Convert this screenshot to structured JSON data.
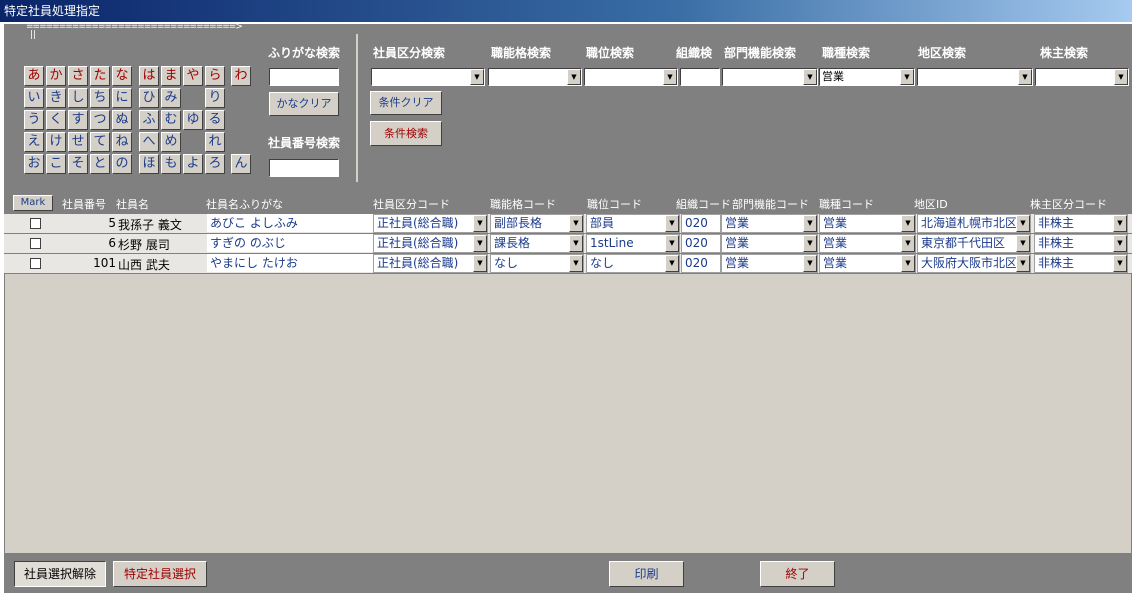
{
  "window": {
    "title": "特定社員処理指定"
  },
  "kana": {
    "arrow": "================================>",
    "tick": "||",
    "rows": [
      [
        "あ",
        "か",
        "さ",
        "た",
        "な",
        "は",
        "ま",
        "や",
        "ら",
        "わ"
      ],
      [
        "い",
        "き",
        "し",
        "ち",
        "に",
        "ひ",
        "み",
        "",
        "り",
        ""
      ],
      [
        "う",
        "く",
        "す",
        "つ",
        "ぬ",
        "ふ",
        "む",
        "ゆ",
        "る",
        ""
      ],
      [
        "え",
        "け",
        "せ",
        "て",
        "ね",
        "へ",
        "め",
        "",
        "れ",
        ""
      ],
      [
        "お",
        "こ",
        "そ",
        "と",
        "の",
        "ほ",
        "も",
        "よ",
        "ろ",
        "ん"
      ]
    ]
  },
  "search": {
    "furigana_label": "ふりがな検索",
    "kana_clear": "かなクリア",
    "empno_label": "社員番号検索",
    "labels": {
      "shain_kubun": "社員区分検索",
      "nouryoku": "職能格検索",
      "shokui": "職位検索",
      "soshiki": "組織検",
      "bumon": "部門機能検索",
      "shokushu": "職種検索",
      "chiku": "地区検索",
      "kabunushi": "株主検索"
    },
    "shokushu_value": "営業",
    "cond_clear": "条件クリア",
    "cond_search": "条件検索"
  },
  "list": {
    "mark": "Mark",
    "headers": {
      "no": "社員番号",
      "name": "社員名",
      "furi": "社員名ふりがな",
      "kubun": "社員区分コード",
      "nouryoku": "職能格コード",
      "shokui": "職位コード",
      "soshiki": "組織コード",
      "bumon": "部門機能コード",
      "shokushu": "職種コード",
      "chiku": "地区ID",
      "kabu": "株主区分コード"
    },
    "rows": [
      {
        "no": "5",
        "name": "我孫子 義文",
        "furi": "あびこ よしふみ",
        "kubun": "正社員(総合職)",
        "nouryoku": "副部長格",
        "shokui": "部員",
        "soshiki": "020",
        "bumon": "営業",
        "shokushu": "営業",
        "chiku": "北海道札幌市北区",
        "kabu": "非株主"
      },
      {
        "no": "6",
        "name": "杉野 展司",
        "furi": "すぎの のぶじ",
        "kubun": "正社員(総合職)",
        "nouryoku": "課長格",
        "shokui": "1stLine",
        "soshiki": "020",
        "bumon": "営業",
        "shokushu": "営業",
        "chiku": "東京都千代田区",
        "kabu": "非株主"
      },
      {
        "no": "101",
        "name": "山西 武夫",
        "furi": "やまにし たけお",
        "kubun": "正社員(総合職)",
        "nouryoku": "なし",
        "shokui": "なし",
        "soshiki": "020",
        "bumon": "営業",
        "shokushu": "営業",
        "chiku": "大阪府大阪市北区",
        "kabu": "非株主"
      }
    ]
  },
  "footer": {
    "deselect": "社員選択解除",
    "select": "特定社員選択",
    "print": "印刷",
    "exit": "終了"
  },
  "colors": {
    "panel": "#808080",
    "red": "#a00000",
    "blue": "#1a3a8a"
  }
}
